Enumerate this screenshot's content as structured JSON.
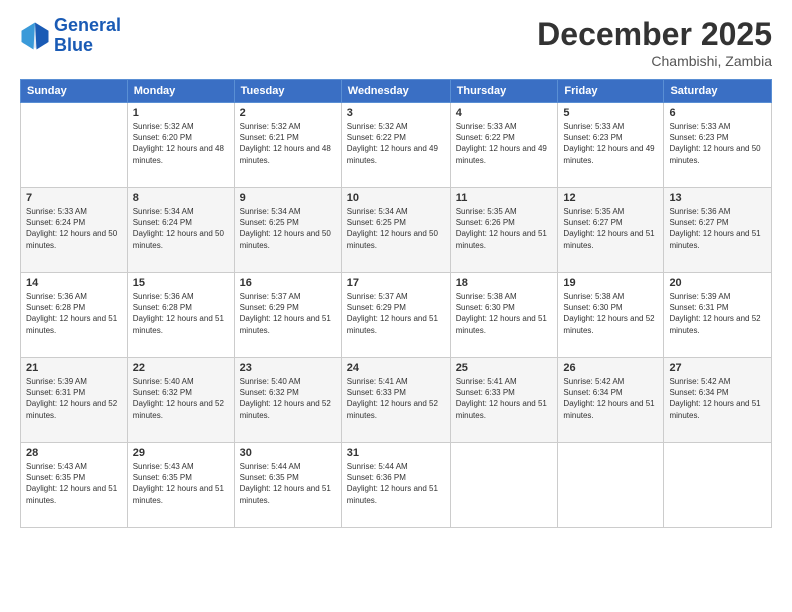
{
  "logo": {
    "line1": "General",
    "line2": "Blue"
  },
  "title": "December 2025",
  "location": "Chambishi, Zambia",
  "days_header": [
    "Sunday",
    "Monday",
    "Tuesday",
    "Wednesday",
    "Thursday",
    "Friday",
    "Saturday"
  ],
  "weeks": [
    [
      {
        "day": "",
        "sunrise": "",
        "sunset": "",
        "daylight": ""
      },
      {
        "day": "1",
        "sunrise": "Sunrise: 5:32 AM",
        "sunset": "Sunset: 6:20 PM",
        "daylight": "Daylight: 12 hours and 48 minutes."
      },
      {
        "day": "2",
        "sunrise": "Sunrise: 5:32 AM",
        "sunset": "Sunset: 6:21 PM",
        "daylight": "Daylight: 12 hours and 48 minutes."
      },
      {
        "day": "3",
        "sunrise": "Sunrise: 5:32 AM",
        "sunset": "Sunset: 6:22 PM",
        "daylight": "Daylight: 12 hours and 49 minutes."
      },
      {
        "day": "4",
        "sunrise": "Sunrise: 5:33 AM",
        "sunset": "Sunset: 6:22 PM",
        "daylight": "Daylight: 12 hours and 49 minutes."
      },
      {
        "day": "5",
        "sunrise": "Sunrise: 5:33 AM",
        "sunset": "Sunset: 6:23 PM",
        "daylight": "Daylight: 12 hours and 49 minutes."
      },
      {
        "day": "6",
        "sunrise": "Sunrise: 5:33 AM",
        "sunset": "Sunset: 6:23 PM",
        "daylight": "Daylight: 12 hours and 50 minutes."
      }
    ],
    [
      {
        "day": "7",
        "sunrise": "Sunrise: 5:33 AM",
        "sunset": "Sunset: 6:24 PM",
        "daylight": "Daylight: 12 hours and 50 minutes."
      },
      {
        "day": "8",
        "sunrise": "Sunrise: 5:34 AM",
        "sunset": "Sunset: 6:24 PM",
        "daylight": "Daylight: 12 hours and 50 minutes."
      },
      {
        "day": "9",
        "sunrise": "Sunrise: 5:34 AM",
        "sunset": "Sunset: 6:25 PM",
        "daylight": "Daylight: 12 hours and 50 minutes."
      },
      {
        "day": "10",
        "sunrise": "Sunrise: 5:34 AM",
        "sunset": "Sunset: 6:25 PM",
        "daylight": "Daylight: 12 hours and 50 minutes."
      },
      {
        "day": "11",
        "sunrise": "Sunrise: 5:35 AM",
        "sunset": "Sunset: 6:26 PM",
        "daylight": "Daylight: 12 hours and 51 minutes."
      },
      {
        "day": "12",
        "sunrise": "Sunrise: 5:35 AM",
        "sunset": "Sunset: 6:27 PM",
        "daylight": "Daylight: 12 hours and 51 minutes."
      },
      {
        "day": "13",
        "sunrise": "Sunrise: 5:36 AM",
        "sunset": "Sunset: 6:27 PM",
        "daylight": "Daylight: 12 hours and 51 minutes."
      }
    ],
    [
      {
        "day": "14",
        "sunrise": "Sunrise: 5:36 AM",
        "sunset": "Sunset: 6:28 PM",
        "daylight": "Daylight: 12 hours and 51 minutes."
      },
      {
        "day": "15",
        "sunrise": "Sunrise: 5:36 AM",
        "sunset": "Sunset: 6:28 PM",
        "daylight": "Daylight: 12 hours and 51 minutes."
      },
      {
        "day": "16",
        "sunrise": "Sunrise: 5:37 AM",
        "sunset": "Sunset: 6:29 PM",
        "daylight": "Daylight: 12 hours and 51 minutes."
      },
      {
        "day": "17",
        "sunrise": "Sunrise: 5:37 AM",
        "sunset": "Sunset: 6:29 PM",
        "daylight": "Daylight: 12 hours and 51 minutes."
      },
      {
        "day": "18",
        "sunrise": "Sunrise: 5:38 AM",
        "sunset": "Sunset: 6:30 PM",
        "daylight": "Daylight: 12 hours and 51 minutes."
      },
      {
        "day": "19",
        "sunrise": "Sunrise: 5:38 AM",
        "sunset": "Sunset: 6:30 PM",
        "daylight": "Daylight: 12 hours and 52 minutes."
      },
      {
        "day": "20",
        "sunrise": "Sunrise: 5:39 AM",
        "sunset": "Sunset: 6:31 PM",
        "daylight": "Daylight: 12 hours and 52 minutes."
      }
    ],
    [
      {
        "day": "21",
        "sunrise": "Sunrise: 5:39 AM",
        "sunset": "Sunset: 6:31 PM",
        "daylight": "Daylight: 12 hours and 52 minutes."
      },
      {
        "day": "22",
        "sunrise": "Sunrise: 5:40 AM",
        "sunset": "Sunset: 6:32 PM",
        "daylight": "Daylight: 12 hours and 52 minutes."
      },
      {
        "day": "23",
        "sunrise": "Sunrise: 5:40 AM",
        "sunset": "Sunset: 6:32 PM",
        "daylight": "Daylight: 12 hours and 52 minutes."
      },
      {
        "day": "24",
        "sunrise": "Sunrise: 5:41 AM",
        "sunset": "Sunset: 6:33 PM",
        "daylight": "Daylight: 12 hours and 52 minutes."
      },
      {
        "day": "25",
        "sunrise": "Sunrise: 5:41 AM",
        "sunset": "Sunset: 6:33 PM",
        "daylight": "Daylight: 12 hours and 51 minutes."
      },
      {
        "day": "26",
        "sunrise": "Sunrise: 5:42 AM",
        "sunset": "Sunset: 6:34 PM",
        "daylight": "Daylight: 12 hours and 51 minutes."
      },
      {
        "day": "27",
        "sunrise": "Sunrise: 5:42 AM",
        "sunset": "Sunset: 6:34 PM",
        "daylight": "Daylight: 12 hours and 51 minutes."
      }
    ],
    [
      {
        "day": "28",
        "sunrise": "Sunrise: 5:43 AM",
        "sunset": "Sunset: 6:35 PM",
        "daylight": "Daylight: 12 hours and 51 minutes."
      },
      {
        "day": "29",
        "sunrise": "Sunrise: 5:43 AM",
        "sunset": "Sunset: 6:35 PM",
        "daylight": "Daylight: 12 hours and 51 minutes."
      },
      {
        "day": "30",
        "sunrise": "Sunrise: 5:44 AM",
        "sunset": "Sunset: 6:35 PM",
        "daylight": "Daylight: 12 hours and 51 minutes."
      },
      {
        "day": "31",
        "sunrise": "Sunrise: 5:44 AM",
        "sunset": "Sunset: 6:36 PM",
        "daylight": "Daylight: 12 hours and 51 minutes."
      },
      {
        "day": "",
        "sunrise": "",
        "sunset": "",
        "daylight": ""
      },
      {
        "day": "",
        "sunrise": "",
        "sunset": "",
        "daylight": ""
      },
      {
        "day": "",
        "sunrise": "",
        "sunset": "",
        "daylight": ""
      }
    ]
  ]
}
